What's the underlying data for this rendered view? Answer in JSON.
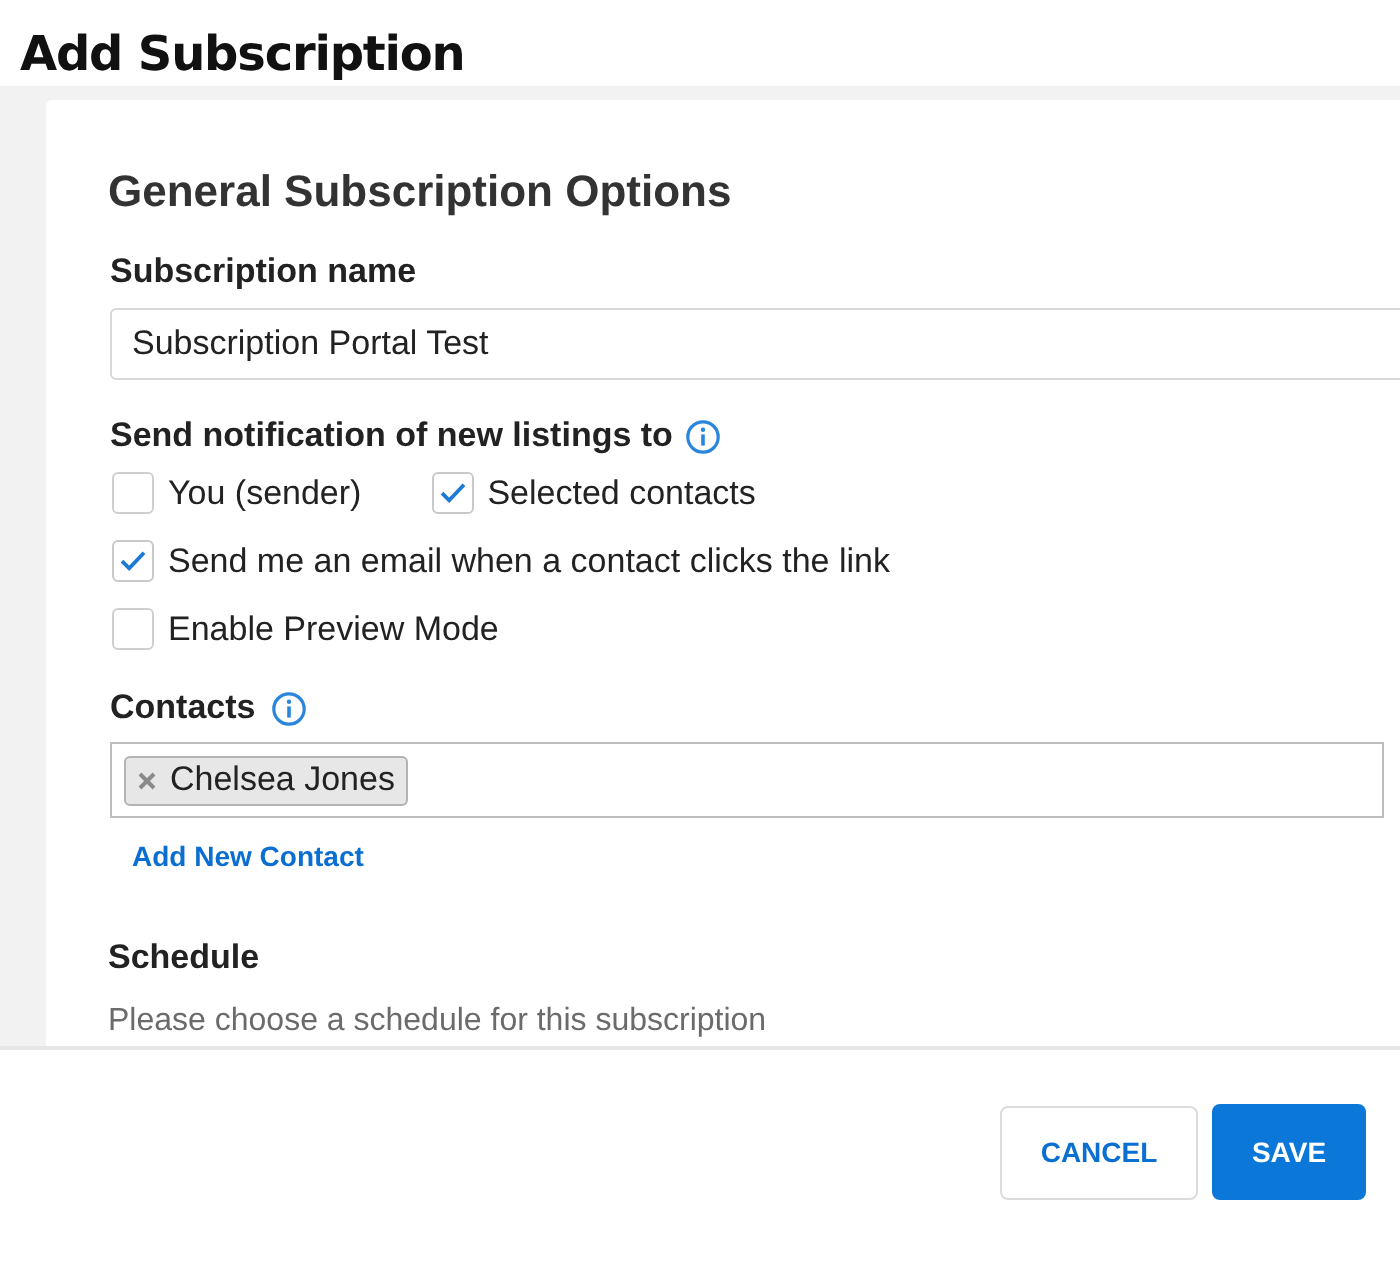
{
  "page": {
    "title": "Add Subscription"
  },
  "section": {
    "title": "General Subscription Options"
  },
  "subscription_name": {
    "label": "Subscription name",
    "value": "Subscription Portal Test"
  },
  "notification": {
    "label": "Send notification of new listings to",
    "options": [
      {
        "label": "You (sender)",
        "checked": false
      },
      {
        "label": "Selected contacts",
        "checked": true
      }
    ]
  },
  "settings": [
    {
      "label": "Send me an email when a contact clicks the link",
      "checked": true
    },
    {
      "label": "Enable Preview Mode",
      "checked": false
    }
  ],
  "contacts": {
    "label": "Contacts",
    "tags": [
      "Chelsea Jones"
    ],
    "add_link": "Add New Contact"
  },
  "schedule": {
    "title": "Schedule",
    "description": "Please choose a schedule for this subscription"
  },
  "buttons": [
    {
      "label": "CANCEL",
      "kind": "secondary"
    },
    {
      "label": "SAVE",
      "kind": "primary"
    }
  ]
}
